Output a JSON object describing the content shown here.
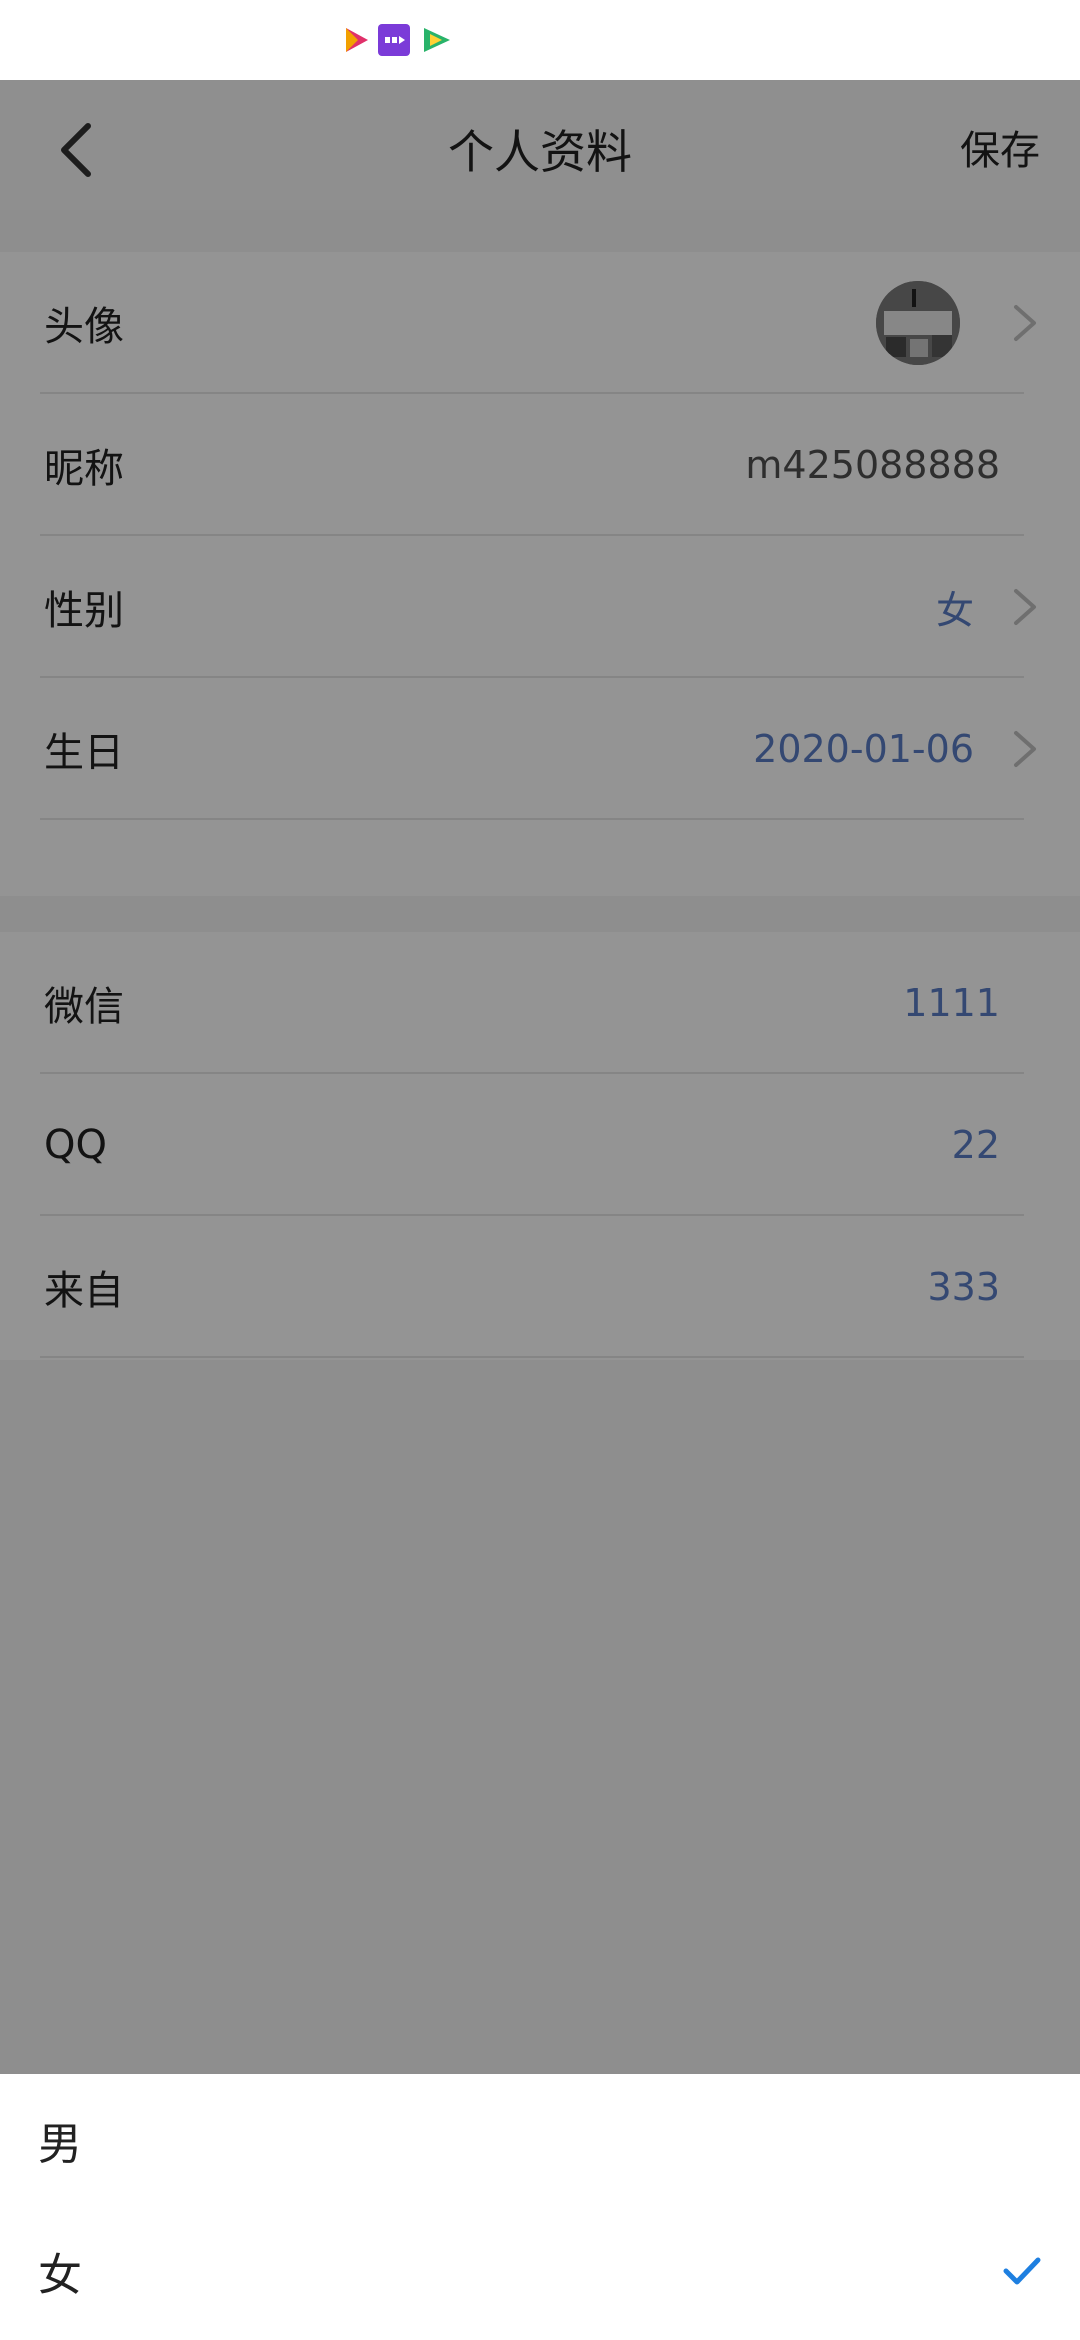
{
  "app": {
    "title": "个人资料",
    "save_label": "保存"
  },
  "status_bar": {
    "icons": [
      "video-play-icon",
      "media-app-icon",
      "video-app-icon"
    ]
  },
  "profile": {
    "avatar_label": "头像",
    "nickname_label": "昵称",
    "nickname_value": "m425088888",
    "gender_label": "性别",
    "gender_value": "女",
    "birthday_label": "生日",
    "birthday_value": "2020-01-06"
  },
  "contact": {
    "wechat_label": "微信",
    "wechat_value": "1111",
    "qq_label": "QQ",
    "qq_value": "22",
    "from_label": "来自",
    "from_value": "333"
  },
  "gender_sheet": {
    "options": [
      {
        "label": "男",
        "selected": false
      },
      {
        "label": "女",
        "selected": true
      }
    ]
  },
  "colors": {
    "accent_value": "#3b6fd6",
    "check": "#1e7fe0",
    "overlay": "rgba(0,0,0,0.42)"
  }
}
